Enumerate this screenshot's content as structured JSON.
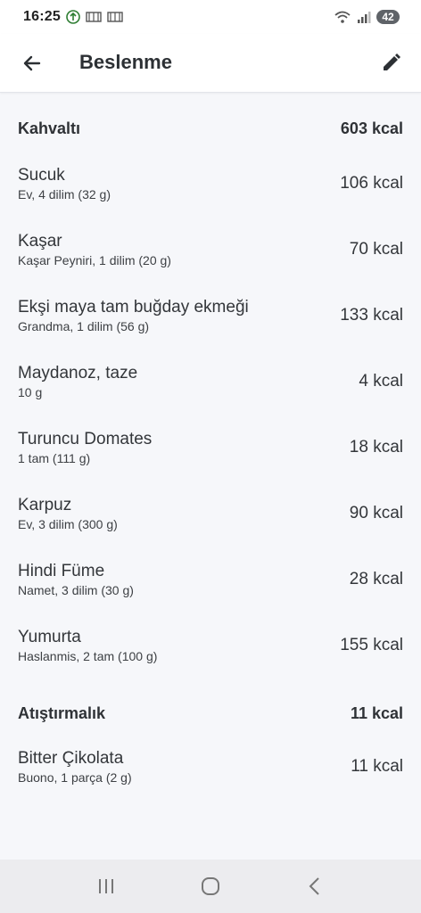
{
  "status_bar": {
    "time": "16:25",
    "battery": "42"
  },
  "app_bar": {
    "title": "Beslenme"
  },
  "meals": [
    {
      "name": "Kahvaltı",
      "total": "603 kcal",
      "items": [
        {
          "name": "Sucuk",
          "detail": "Ev, 4 dilim (32 g)",
          "kcal": "106 kcal"
        },
        {
          "name": "Kaşar",
          "detail": "Kaşar Peyniri, 1 dilim (20 g)",
          "kcal": "70 kcal"
        },
        {
          "name": "Ekşi  maya tam buğday ekmeği",
          "detail": "Grandma, 1 dilim (56 g)",
          "kcal": "133 kcal"
        },
        {
          "name": "Maydanoz, taze",
          "detail": "10 g",
          "kcal": "4 kcal"
        },
        {
          "name": "Turuncu Domates",
          "detail": "1 tam (111 g)",
          "kcal": "18 kcal"
        },
        {
          "name": "Karpuz",
          "detail": "Ev, 3 dilim (300 g)",
          "kcal": "90 kcal"
        },
        {
          "name": "Hindi Füme",
          "detail": "Namet, 3 dilim (30 g)",
          "kcal": "28 kcal"
        },
        {
          "name": "Yumurta",
          "detail": "Haslanmis, 2 tam (100 g)",
          "kcal": "155 kcal"
        }
      ]
    },
    {
      "name": "Atıştırmalık",
      "total": "11 kcal",
      "items": [
        {
          "name": "Bitter Çikolata",
          "detail": "Buono, 1 parça (2 g)",
          "kcal": "11 kcal"
        }
      ]
    }
  ],
  "icons": {
    "back": "arrow-left-icon",
    "edit": "pencil-icon",
    "nav_recents": "recents-icon",
    "nav_home": "home-icon",
    "nav_back": "nav-back-icon"
  },
  "colors": {
    "background": "#f6f7fa",
    "app_bar": "#ffffff",
    "text": "#2c2f33",
    "nav_bar": "#ececef"
  }
}
